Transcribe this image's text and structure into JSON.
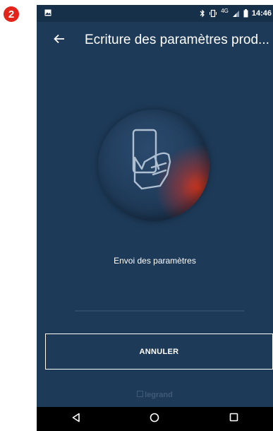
{
  "step_badge": "2",
  "statusbar": {
    "network": "4G",
    "time": "14:46"
  },
  "appbar": {
    "title": "Ecriture des paramètres prod..."
  },
  "main": {
    "status_text": "Envoi des paramètres",
    "progress_fraction": 0.0,
    "cancel_label": "ANNULER"
  },
  "brand": {
    "name": "legrand"
  },
  "colors": {
    "background": "#1d3a58",
    "statusbar": "#16304a",
    "accent": "#e3241b",
    "navbar": "#000000"
  },
  "icons": {
    "back": "arrow-left-icon",
    "hand_phone": "hand-holding-phone-icon",
    "nav_back": "nav-back-triangle-icon",
    "nav_home": "nav-home-circle-icon",
    "nav_recents": "nav-recents-square-icon"
  }
}
